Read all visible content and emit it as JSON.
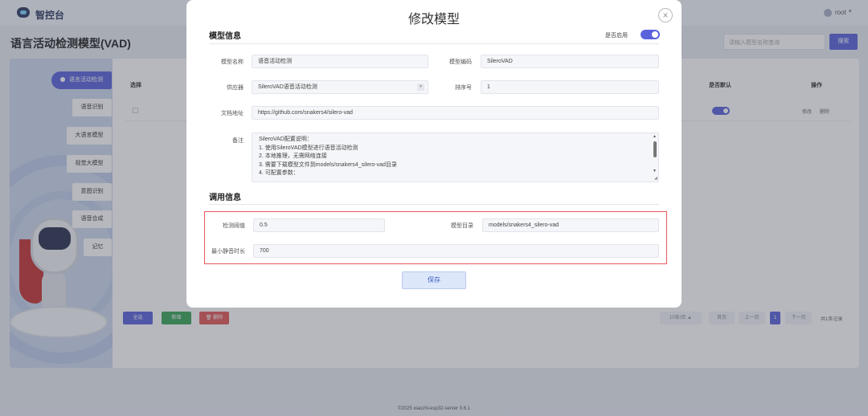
{
  "app": {
    "logo_text": "智控台",
    "user": "root"
  },
  "page": {
    "title": "语言活动检测模型(VAD)",
    "search_placeholder": "请输入模型名称查询",
    "search_button": "搜索"
  },
  "sidebar": {
    "items": [
      {
        "label": "语言活动检测",
        "active": true
      },
      {
        "label": "语音识别"
      },
      {
        "label": "大语言模型"
      },
      {
        "label": "视觉大模型"
      },
      {
        "label": "意图识别"
      },
      {
        "label": "语音合成"
      },
      {
        "label": "记忆"
      }
    ]
  },
  "table": {
    "headers": {
      "select": "选择",
      "default": "是否默认",
      "action": "操作"
    },
    "row": {
      "edit": "修改",
      "delete": "删除",
      "is_default": true
    }
  },
  "bottom_bar": {
    "select_all": "全选",
    "add": "新增",
    "delete": "删除",
    "page_size": "10条/页",
    "first": "首页",
    "prev": "上一页",
    "current": "1",
    "next": "下一页",
    "total": "共1条记录"
  },
  "footer": "©2025 xiaozhi-esp32-server 0.6.1",
  "modal": {
    "title": "修改模型",
    "close_icon": "×",
    "section_model_info": "模型信息",
    "enable_label": "是否启用",
    "enabled": true,
    "fields": {
      "model_name": {
        "label": "模型名称",
        "value": "语音活动检测"
      },
      "model_code": {
        "label": "模型编码",
        "value": "SileroVAD"
      },
      "supplier": {
        "label": "供应器",
        "value": "SileroVAD语音活动检测"
      },
      "sort": {
        "label": "排序号",
        "value": "1"
      },
      "doc_url": {
        "label": "文档地址",
        "value": "https://github.com/snakers4/silero-vad"
      },
      "remark": {
        "label": "备注",
        "lines": [
          "SileroVAD配置说明：",
          "1. 使用SileroVAD模型进行语音活动检测",
          "2. 本地推理，无需网络连接",
          "3. 需要下载模型文件到models/snakers4_silero-vad目录",
          "4. 可配置参数："
        ]
      }
    },
    "section_call_info": "调用信息",
    "call_fields": {
      "threshold": {
        "label": "检测阈值",
        "value": "0.5"
      },
      "model_dir": {
        "label": "模型目录",
        "value": "models/snakers4_silero-vad"
      },
      "min_silence": {
        "label": "最小静音时长",
        "value": "700"
      }
    },
    "save_label": "保存"
  },
  "colors": {
    "accent": "#5b63dc",
    "highlight_border": "#e7585f",
    "danger": "#e25a5a",
    "success": "#3aa55a"
  }
}
